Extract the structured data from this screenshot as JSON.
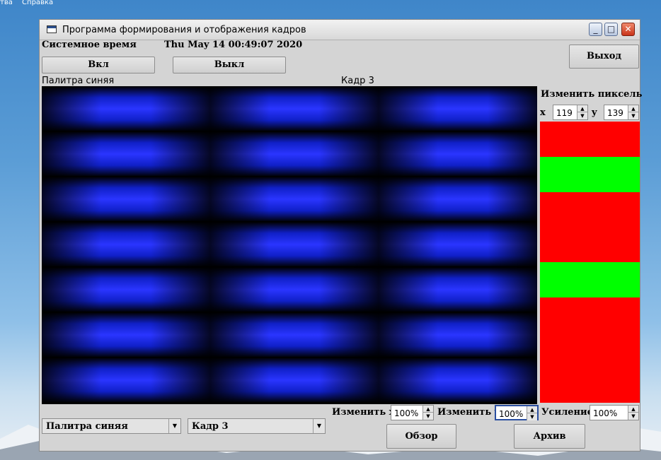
{
  "desktop": {
    "menu": [
      "тва",
      "Справка"
    ]
  },
  "window": {
    "title": "Программа формирования и отображения кадров",
    "controls": {
      "minimize": "_",
      "maximize": "□",
      "close": "✕"
    }
  },
  "system_time": {
    "label": "Системное время",
    "value": "Thu May 14 00:49:07 2020"
  },
  "buttons": {
    "on": "Вкл",
    "off": "Выкл",
    "exit": "Выход",
    "browse": "Обзор",
    "archive": "Архив"
  },
  "frame_view": {
    "palette_caption": "Палитра синяя",
    "frame_caption": "Кадр 3",
    "colors": {
      "bright": "#2a35ff",
      "mid": "#1020c8",
      "dark": "#000000"
    }
  },
  "pixel_editor": {
    "title": "Изменить пиксель",
    "x_label": "x",
    "x_value": "119",
    "y_label": "y",
    "y_value": "139",
    "stripes": [
      {
        "color": "#ff0000"
      },
      {
        "color": "#00ff00"
      },
      {
        "color": "#ff0000"
      },
      {
        "color": "#ff0000"
      },
      {
        "color": "#00ff00"
      },
      {
        "color": "#ff0000"
      },
      {
        "color": "#ff0000"
      },
      {
        "color": "#ff0000"
      }
    ]
  },
  "scale": {
    "x_label": "Изменить x",
    "x_value": "100%",
    "y_label": "Изменить y",
    "y_value": "100%",
    "gain_label": "Усиление",
    "gain_value": "100%"
  },
  "palette_select": {
    "selected": "Палитра синяя"
  },
  "frame_select": {
    "selected": "Кадр 3"
  }
}
